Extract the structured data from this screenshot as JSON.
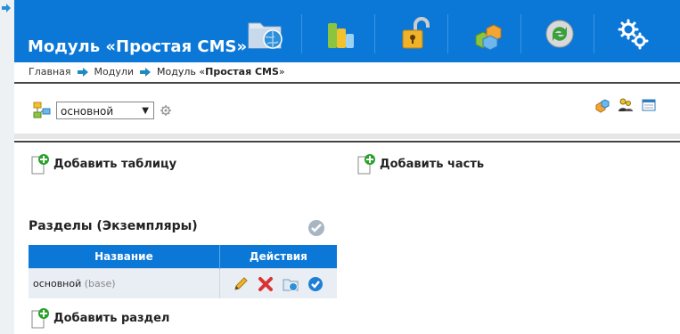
{
  "header": {
    "title": "Модуль «Простая CMS»",
    "accent_color": "#0b78d8",
    "nav_icons": [
      "folder-globe-icon",
      "bars-icon",
      "padlock-icon",
      "boxes-icon",
      "refresh-icon",
      "gears-icon"
    ]
  },
  "breadcrumb": {
    "items": [
      "Главная",
      "Модули"
    ],
    "current_prefix": "Модуль «",
    "current_bold": "Простая CMS",
    "current_suffix": "»"
  },
  "toolbar": {
    "select_value": "основной"
  },
  "actions": {
    "add_table": "Добавить таблицу",
    "add_part": "Добавить часть",
    "add_section": "Добавить раздел"
  },
  "sections": {
    "title": "Разделы (Экземпляры)",
    "columns": [
      "Название",
      "Действия"
    ],
    "rows": [
      {
        "name": "основной",
        "tag": "(base)"
      }
    ]
  }
}
